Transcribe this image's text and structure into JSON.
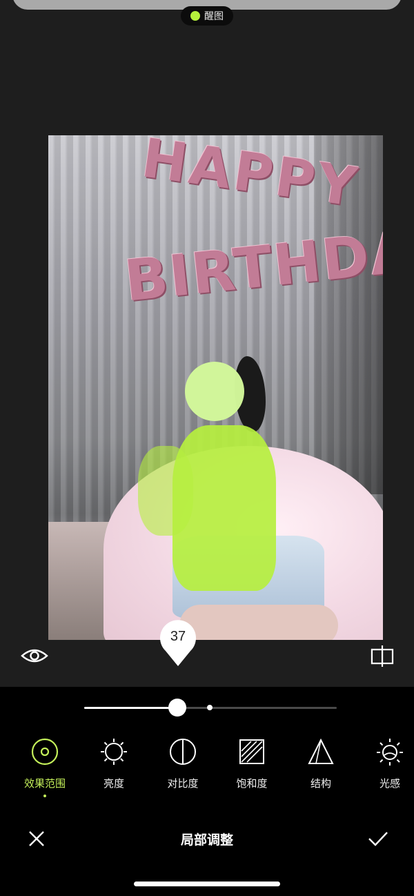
{
  "status": {
    "app_name": "醒图",
    "app_dot_color": "#b6f23c"
  },
  "photo": {
    "balloon_row1": "HAPPY",
    "balloon_row2": "BIRTHDAY",
    "mask_color": "#b6ef3f"
  },
  "adjust": {
    "value": "37",
    "slider_level": 0.37
  },
  "tools": [
    {
      "label": "效果范围",
      "icon": "target-icon",
      "active": true
    },
    {
      "label": "亮度",
      "icon": "brightness-icon",
      "active": false
    },
    {
      "label": "对比度",
      "icon": "contrast-icon",
      "active": false
    },
    {
      "label": "饱和度",
      "icon": "saturation-icon",
      "active": false
    },
    {
      "label": "结构",
      "icon": "structure-icon",
      "active": false
    },
    {
      "label": "光感",
      "icon": "light-icon",
      "active": false
    }
  ],
  "bottom_bar": {
    "title": "局部调整"
  },
  "colors": {
    "accent": "#c4f05a",
    "background": "#1e1e1e",
    "panel": "#000000"
  }
}
